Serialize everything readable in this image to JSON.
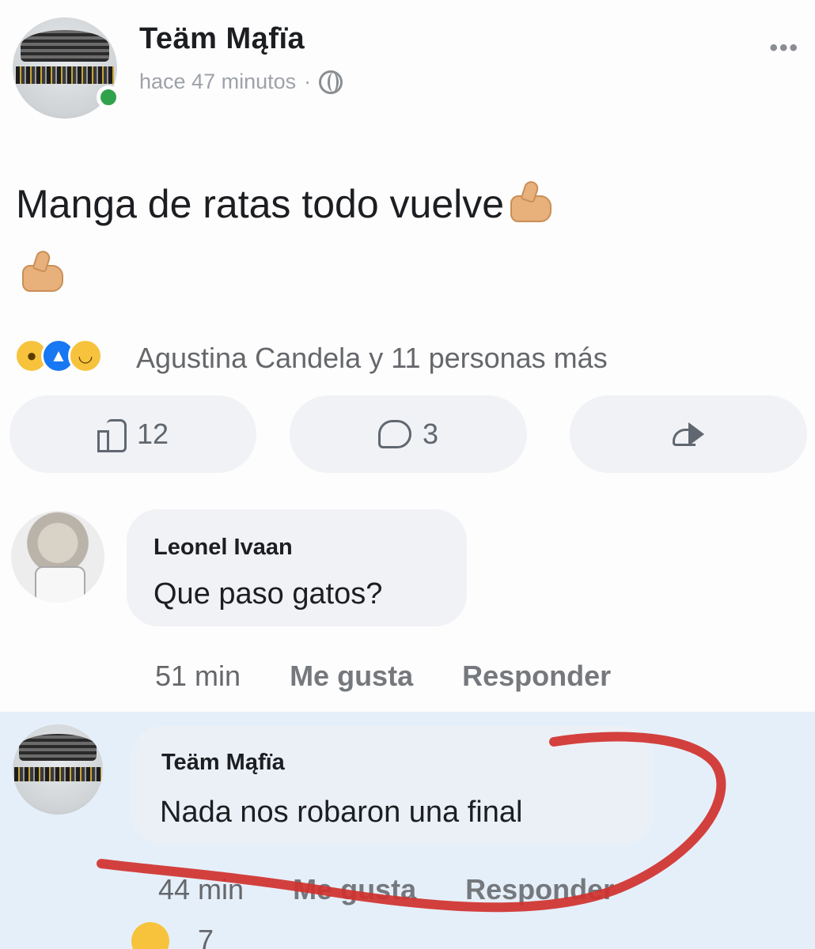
{
  "post": {
    "author": "Teäm Mąfïa",
    "time": "hace 47 minutos",
    "separator": "·",
    "more_label": "•••",
    "text": "Manga de ratas todo vuelve",
    "emoji": "thumbs-up-icon",
    "reactions_summary": "Agustina Candela y 11 personas más",
    "like_count": "12",
    "comment_count": "3"
  },
  "comments": [
    {
      "author": "Leonel Ivaan",
      "text": "Que paso gatos?",
      "time": "51 min",
      "like_label": "Me gusta",
      "reply_label": "Responder"
    },
    {
      "author": "Teäm Mąfïa",
      "text": "Nada nos robaron una final",
      "time": "44 min",
      "like_label": "Me gusta",
      "reply_label": "Responder",
      "reaction_count": "7"
    }
  ],
  "colors": {
    "like_blue": "#1877f2",
    "online_green": "#31a24c",
    "highlight_bg": "#e5effa",
    "annotation_red": "#d0312d"
  }
}
